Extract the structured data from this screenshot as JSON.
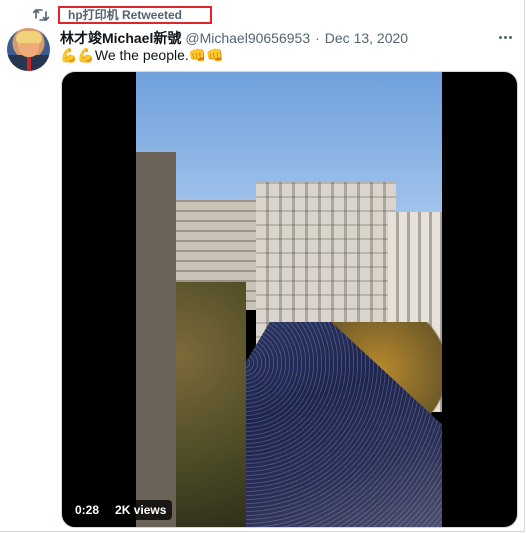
{
  "retweet": {
    "label": "hp打印机 Retweeted",
    "icon": "retweet-icon"
  },
  "author": {
    "display_name": "林才竣Michael新號",
    "handle": "@Michael90656953",
    "separator": "·",
    "date": "Dec 13, 2020",
    "avatar_icon": "avatar"
  },
  "tweet": {
    "text": "💪💪We the people.👊👊"
  },
  "video": {
    "duration": "0:28",
    "views": "2K views"
  },
  "colors": {
    "retweet_highlight": "#e0242e",
    "secondary_text": "#536471",
    "border": "#cfd9de"
  }
}
